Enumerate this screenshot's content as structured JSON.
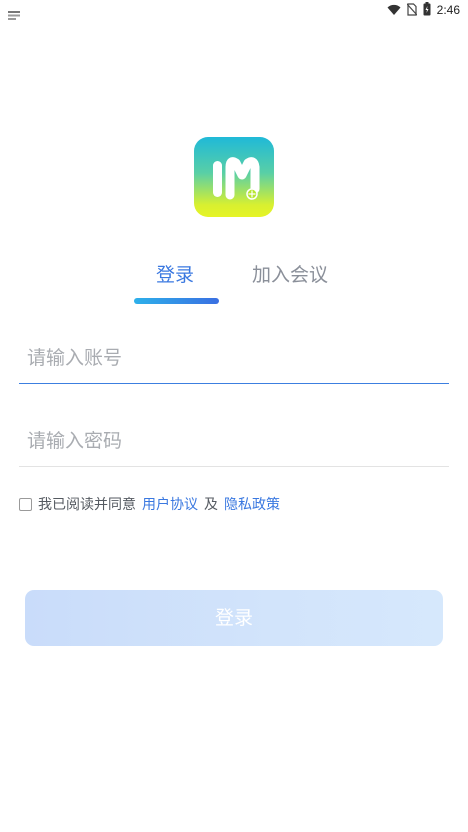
{
  "status_bar": {
    "time": "2:46",
    "icons": [
      "notification-icon",
      "wifi-icon",
      "no-sim-icon",
      "battery-icon"
    ]
  },
  "logo": {
    "icon": "app-logo-icon",
    "colors": [
      "#1fb9d8",
      "#e6f426"
    ]
  },
  "tabs": [
    {
      "label": "登录",
      "active": true
    },
    {
      "label": "加入会议",
      "active": false
    }
  ],
  "form": {
    "account_placeholder": "请输入账号",
    "password_placeholder": "请输入密码",
    "agreement_prefix": "我已阅读并同意",
    "user_agreement": "用户协议",
    "and": "及",
    "privacy_policy": "隐私政策",
    "checked": false
  },
  "login_button": {
    "label": "登录"
  },
  "colors": {
    "accent": "#3a78e0",
    "tab_inactive": "#8a8f99",
    "button_bg": "#d2e4fb"
  }
}
